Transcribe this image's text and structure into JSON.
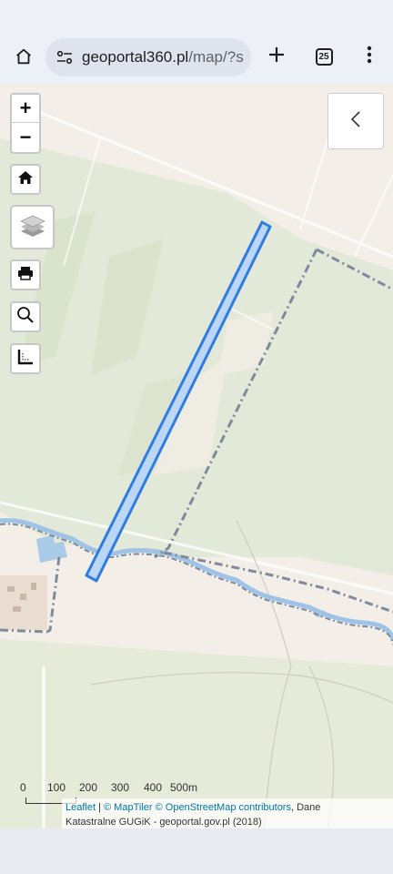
{
  "browser": {
    "url_host": "geoportal360.pl",
    "url_path": "/map/?s",
    "tab_count": "25",
    "icons": {
      "home": "home-icon",
      "site_settings": "tune-icon",
      "new_tab": "plus-icon",
      "tabs": "tab-switcher-icon",
      "menu": "more-vert-icon"
    }
  },
  "map_controls": {
    "zoom_in": "+",
    "zoom_out": "−",
    "icons": {
      "home": "home-icon",
      "layers": "layers-icon",
      "print": "printer-icon",
      "search": "magnifier-icon",
      "measure": "measure-area-icon",
      "panel_toggle": "chevron-left-icon"
    }
  },
  "scale": {
    "labels": [
      "0",
      "100",
      "200",
      "300",
      "400",
      "500m"
    ]
  },
  "attribution": {
    "leaflet": "Leaflet",
    "sep": " | ",
    "maptiler": "© MapTiler",
    "osm": "© OpenStreetMap contributors",
    "rest_line1": ", Dane",
    "line2": "Katastralne GUGiK - geoportal.gov.pl (2018)"
  },
  "colors": {
    "map_background": "#f3efe8",
    "forest": "#dfe6d3",
    "parcel_fill": "#bcd7f6",
    "parcel_stroke": "#2f7de1",
    "boundary": "#7f8a9a",
    "water": "#a9cbe8"
  }
}
